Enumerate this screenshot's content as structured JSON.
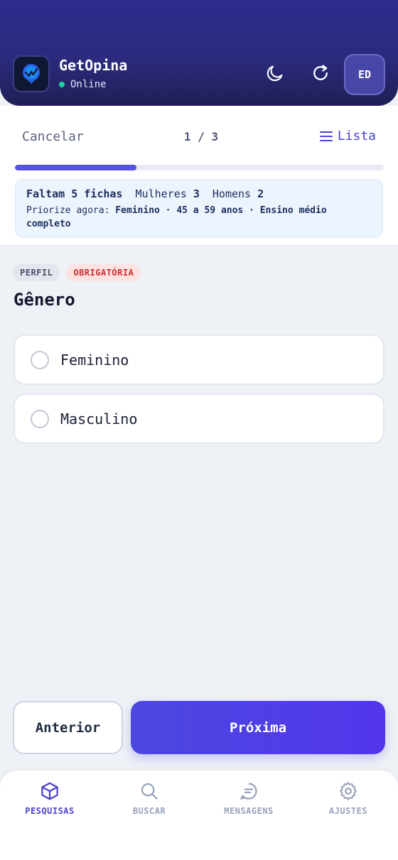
{
  "header": {
    "app_title": "GetOpina",
    "status": "Online",
    "avatar_initials": "ED",
    "icons": [
      "moon-icon",
      "refresh-icon"
    ]
  },
  "form_nav": {
    "cancel_label": "Cancelar",
    "counter": "1 / 3",
    "list_label": "Lista",
    "progress_fraction": 0.33
  },
  "quota": {
    "remaining": "Faltam 5 fichas",
    "women_label": "Mulheres",
    "women_count": "3",
    "men_label": "Homens",
    "men_count": "2",
    "priority_label": "Priorize agora:",
    "priority_values": "Feminino · 45 a 59 anos · Ensino médio completo"
  },
  "question": {
    "tags": [
      "PERFIL",
      "OBRIGATÓRIA"
    ],
    "title": "Gênero",
    "options": [
      "Feminino",
      "Masculino"
    ]
  },
  "actions": {
    "prev_label": "Anterior",
    "next_label": "Próxima"
  },
  "bottom_nav": {
    "items": [
      {
        "label": "PESQUISAS",
        "icon": "box-icon",
        "active": true
      },
      {
        "label": "BUSCAR",
        "icon": "search-icon",
        "active": false
      },
      {
        "label": "MENSAGENS",
        "icon": "chat-icon",
        "active": false
      },
      {
        "label": "AJUSTES",
        "icon": "gear-icon",
        "active": false
      }
    ]
  },
  "colors": {
    "header_bg": "#2f2c8c",
    "accent": "#5553e0",
    "required_tag": "#c9302c",
    "online": "#1ed3a0"
  }
}
